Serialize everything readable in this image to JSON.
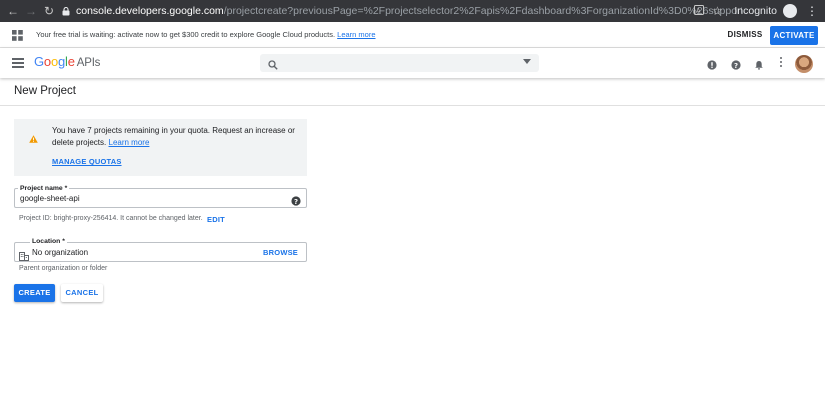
{
  "browser": {
    "url_host": "console.developers.google.com",
    "url_rest": "/projectcreate?previousPage=%2Fprojectselector2%2Fapis%2Fdashboard%3ForganizationId%3D0%26supportedpurview%3Dproj...",
    "incognito_label": "Incognito"
  },
  "trial_banner": {
    "text": "Your free trial is waiting: activate now to get $300 credit to explore Google Cloud products.",
    "link": "Learn more",
    "dismiss": "DISMISS",
    "activate": "ACTIVATE"
  },
  "app_bar": {
    "logo_letters": [
      "G",
      "o",
      "o",
      "g",
      "l",
      "e"
    ],
    "logo_suffix": "APIs",
    "search_placeholder": ""
  },
  "page": {
    "title": "New Project"
  },
  "quota": {
    "text": "You have 7 projects remaining in your quota. Request an increase or delete projects.",
    "link": "Learn more",
    "manage": "MANAGE QUOTAS"
  },
  "project_name": {
    "label": "Project name *",
    "value": "google-sheet-api",
    "id_hint": "Project ID: bright-proxy-256414. It cannot be changed later.",
    "edit": "EDIT"
  },
  "location": {
    "label": "Location *",
    "value": "No organization",
    "browse": "BROWSE",
    "hint": "Parent organization or folder"
  },
  "actions": {
    "create": "CREATE",
    "cancel": "CANCEL"
  },
  "colors": {
    "accent": "#1a73e8",
    "chrome_dark": "#35363a",
    "panel_grey": "#f1f3f4"
  },
  "icons": [
    "back-arrow-icon",
    "forward-arrow-icon",
    "reload-icon",
    "lock-icon",
    "translate-icon",
    "star-icon",
    "incognito-icon",
    "chrome-menu-icon",
    "gift-icon",
    "hamburger-menu-icon",
    "search-icon",
    "dropdown-caret-icon",
    "support-icon",
    "help-icon",
    "notifications-icon",
    "more-vert-icon",
    "warning-icon",
    "organization-icon"
  ]
}
